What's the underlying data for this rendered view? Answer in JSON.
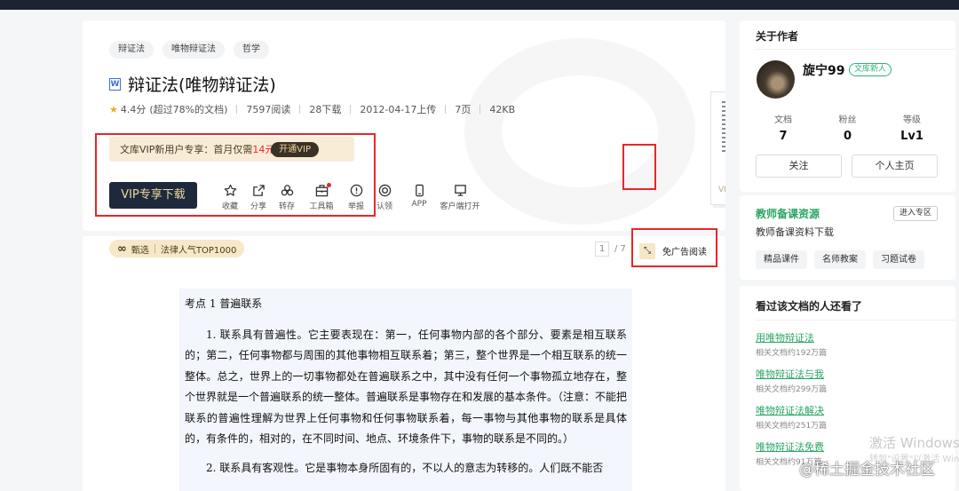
{
  "doc": {
    "tags": [
      "辩证法",
      "唯物辩证法",
      "哲学"
    ],
    "file_icon_letter": "W",
    "title": "辩证法(唯物辩证法)",
    "rating": "4.4分",
    "rating_note": "(超过78%的文档)",
    "views": "7597阅读",
    "downloads": "28下载",
    "upload_date": "2012-04-17上传",
    "pages": "7页",
    "size": "42KB"
  },
  "vip": {
    "promo_text": "文库VIP新用户专享：首月仅需",
    "promo_price": "14元",
    "open_btn": "开通VIP",
    "download_btn": "VIP专享下载",
    "thumb_badge": "VIP"
  },
  "actions": [
    {
      "label": "收藏",
      "icon": "star-icon"
    },
    {
      "label": "分享",
      "icon": "share-icon"
    },
    {
      "label": "转存",
      "icon": "save-to-cloud-icon"
    },
    {
      "label": "工具箱",
      "icon": "toolbox-icon"
    },
    {
      "label": "举报",
      "icon": "report-icon"
    },
    {
      "label": "认领",
      "icon": "claim-icon"
    },
    {
      "label": "APP",
      "icon": "phone-icon"
    },
    {
      "label": "客户端打开",
      "icon": "monitor-icon"
    }
  ],
  "reader": {
    "selection_label": "甄选",
    "selection_tag": "法律人气TOP1000",
    "page_current": "1",
    "page_total": "/ 7",
    "adfree_label": "免广告阅读",
    "heading": "考点 1 普遍联系",
    "para1": "1. 联系具有普遍性。它主要表现在：第一，任何事物内部的各个部分、要素是相互联系的；第二，任何事物都与周围的其他事物相互联系着；第三，整个世界是一个相互联系的统一整体。总之，世界上的一切事物都处在普遍联系之中，其中没有任何一个事物孤立地存在，整个世界就是一个普遍联系的统一整体。普遍联系是事物存在和发展的基本条件。（注意：不能把联系的普遍性理解为世界上任何事物和任何事物联系着，每一事物与其他事物的联系是具体的，有条件的，相对的，在不同时间、地点、环境条件下，事物的联系是不同的。）",
    "para2": "2. 联系具有客观性。它是事物本身所固有的，不以人的意志为转移的。人们既不能否"
  },
  "author": {
    "section_title": "关于作者",
    "name": "旋宁99",
    "badge": "文库新人",
    "stats": [
      {
        "key": "文档",
        "value": "7"
      },
      {
        "key": "粉丝",
        "value": "0"
      },
      {
        "key": "等级",
        "value": "Lv1"
      }
    ],
    "follow_btn": "关注",
    "home_btn": "个人主页"
  },
  "teacher": {
    "title": "教师备课资源",
    "enter_btn": "进入专区",
    "subtitle": "教师备课资料下载",
    "tags": [
      "精品课件",
      "名师教案",
      "习题试卷"
    ]
  },
  "related": {
    "title": "看过该文档的人还看了",
    "items": [
      {
        "title": "用唯物辩证法",
        "sub": "相关文档约192万篇"
      },
      {
        "title": "唯物辩证法与我",
        "sub": "相关文档约299万篇"
      },
      {
        "title": "唯物辩证法解决",
        "sub": "相关文档约251万篇"
      },
      {
        "title": "唯物辩证法免费",
        "sub": "相关文档约91万篇"
      }
    ]
  },
  "watermarks": {
    "windows": "激活 Windows",
    "windows_sub": "转到\"设置\"以激活 Windows",
    "juejin": "@稀土掘金技术社区"
  }
}
